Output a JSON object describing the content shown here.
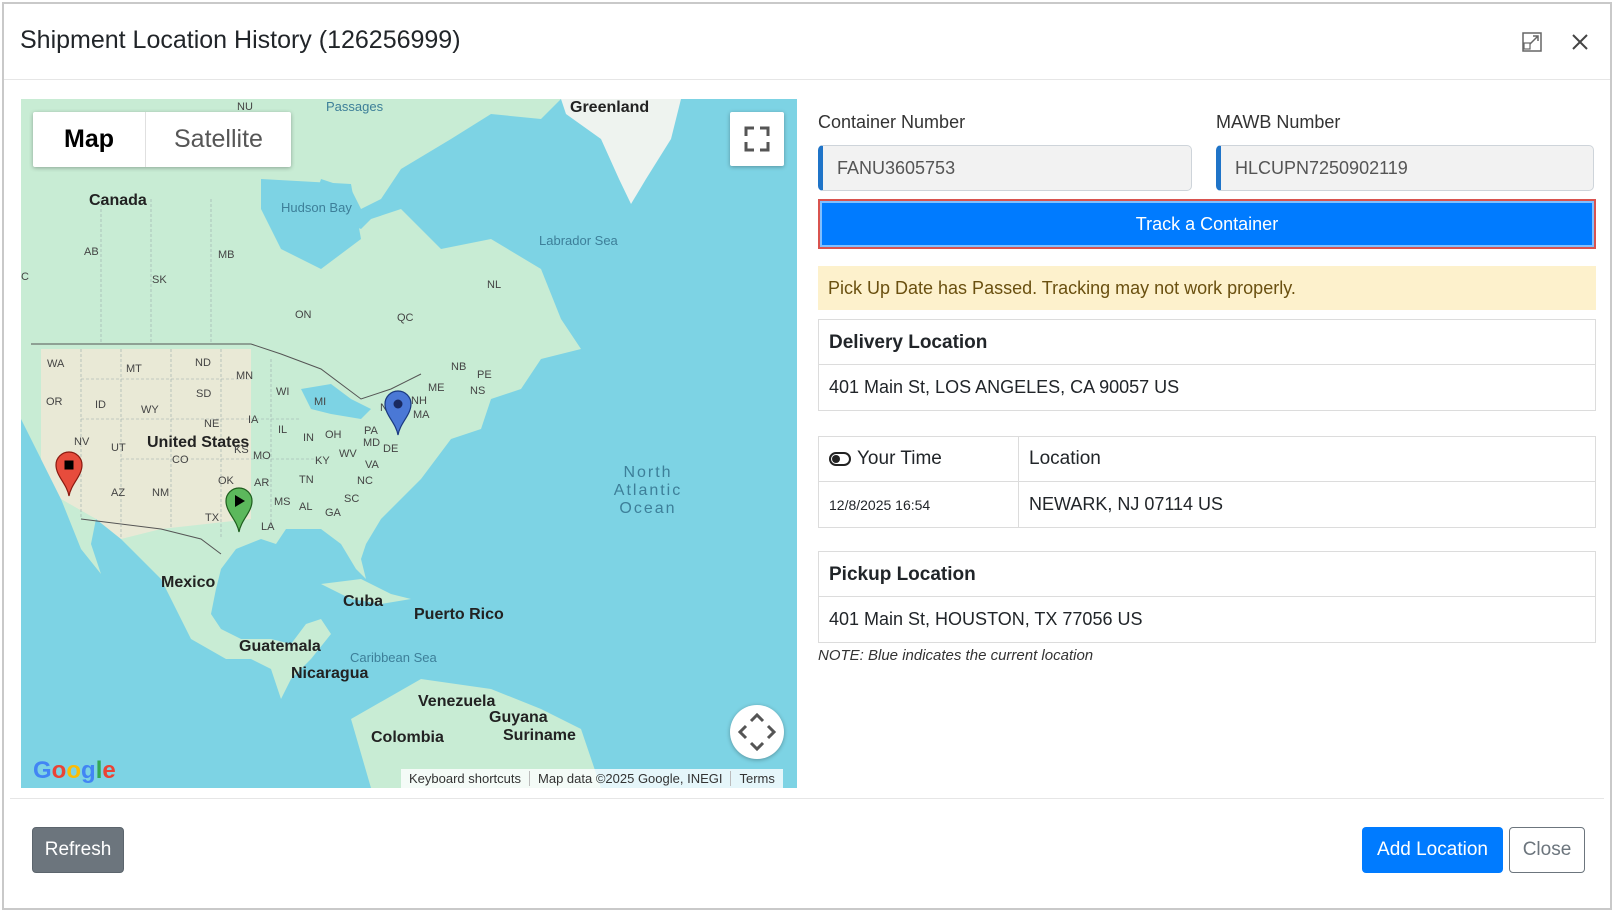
{
  "modal": {
    "title": "Shipment Location History (126256999)",
    "expand_icon": "expand-icon",
    "close_icon": "close-icon"
  },
  "map": {
    "type_options": [
      "Map",
      "Satellite"
    ],
    "selected_type": "Map",
    "labels": {
      "greenland": "Greenland",
      "canada": "Canada",
      "hudson_bay": "Hudson Bay",
      "labrador_sea": "Labrador Sea",
      "passages": "Passages",
      "nu": "NU",
      "united_states": "United States",
      "mexico": "Mexico",
      "cuba": "Cuba",
      "puerto_rico": "Puerto Rico",
      "guatemala": "Guatemala",
      "nicaragua": "Nicaragua",
      "caribbean_sea": "Caribbean Sea",
      "venezuela": "Venezuela",
      "guyana": "Guyana",
      "suriname": "Suriname",
      "colombia": "Colombia",
      "ocean_line1": "North",
      "ocean_line2": "Atlantic",
      "ocean_line3": "Ocean"
    },
    "states": [
      "AB",
      "MB",
      "SK",
      "ON",
      "QC",
      "NL",
      "NB",
      "PE",
      "NS",
      "ME",
      "NH",
      "MA",
      "NY",
      "PA",
      "MD",
      "DE",
      "VA",
      "WV",
      "OH",
      "MI",
      "IN",
      "IL",
      "KY",
      "TN",
      "NC",
      "SC",
      "GA",
      "AL",
      "MS",
      "AR",
      "LA",
      "TX",
      "OK",
      "MO",
      "IA",
      "WI",
      "MN",
      "ND",
      "SD",
      "NE",
      "KS",
      "WY",
      "MT",
      "ID",
      "WA",
      "OR",
      "NV",
      "UT",
      "AZ",
      "NM",
      "CO",
      "C"
    ],
    "logo": "Google",
    "attribution": [
      "Keyboard shortcuts",
      "Map data ©2025 Google, INEGI",
      "Terms"
    ],
    "markers": [
      {
        "name": "delivery-marker",
        "color": "#e74c3c"
      },
      {
        "name": "pickup-marker",
        "color": "#5cb85c"
      },
      {
        "name": "current-marker",
        "color": "#4a78d6"
      }
    ]
  },
  "form": {
    "container_label": "Container Number",
    "container_value": "FANU3605753",
    "mawb_label": "MAWB Number",
    "mawb_value": "HLCUPN7250902119",
    "track_button": "Track a Container"
  },
  "alert": "Pick Up Date has Passed. Tracking may not work properly.",
  "delivery": {
    "heading": "Delivery Location",
    "address": "401 Main St, LOS ANGELES, CA 90057 US"
  },
  "history": {
    "col_time": "Your Time",
    "col_location": "Location",
    "rows": [
      {
        "time": "12/8/2025 16:54",
        "location": "NEWARK, NJ 07114 US"
      }
    ]
  },
  "pickup": {
    "heading": "Pickup Location",
    "address": "401 Main St, HOUSTON, TX 77056 US"
  },
  "note": "NOTE: Blue indicates the current location",
  "footer": {
    "refresh": "Refresh",
    "add_location": "Add Location",
    "close": "Close"
  },
  "colors": {
    "primary": "#007bff",
    "secondary": "#6c757d",
    "alert_bg": "#fdf1cc",
    "water": "#7dd3e4",
    "land": "#c8ecd4"
  }
}
